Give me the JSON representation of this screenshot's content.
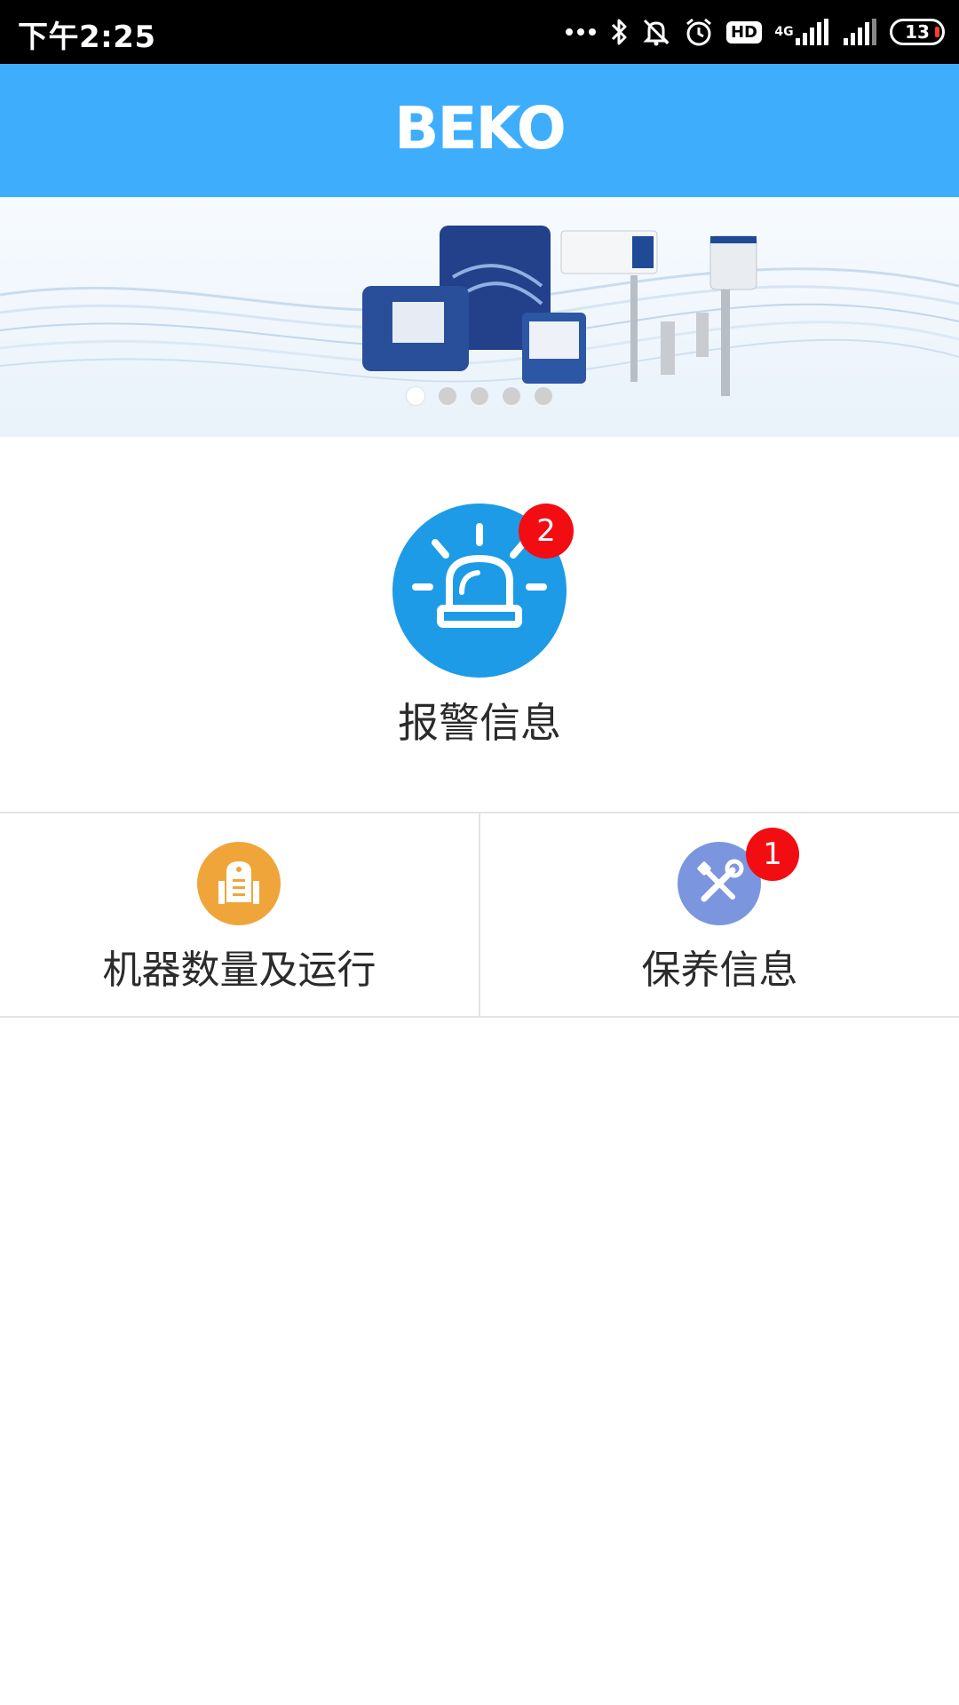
{
  "status_bar": {
    "time": "下午2:25",
    "hd_label": "HD",
    "network_label": "4G",
    "battery_level": "13",
    "icons": [
      "more-dots-icon",
      "bluetooth-icon",
      "mute-icon",
      "alarm-clock-icon",
      "hd-icon",
      "signal-4g-icon",
      "signal-icon",
      "battery-icon"
    ]
  },
  "header": {
    "logo_text": "BEKO",
    "background_color": "#3eaefc"
  },
  "banner": {
    "slide_count": 5,
    "active_slide": 1
  },
  "alarm": {
    "label": "报警信息",
    "badge_count": "2",
    "icon": "siren-icon",
    "color": "#1e9be6"
  },
  "tiles": {
    "machines": {
      "label": "机器数量及运行",
      "icon": "machine-icon",
      "color": "#f0a53a"
    },
    "maintenance": {
      "label": "保养信息",
      "badge_count": "1",
      "icon": "tools-icon",
      "color": "#7b95df"
    }
  },
  "badge_color": "#f20d12"
}
